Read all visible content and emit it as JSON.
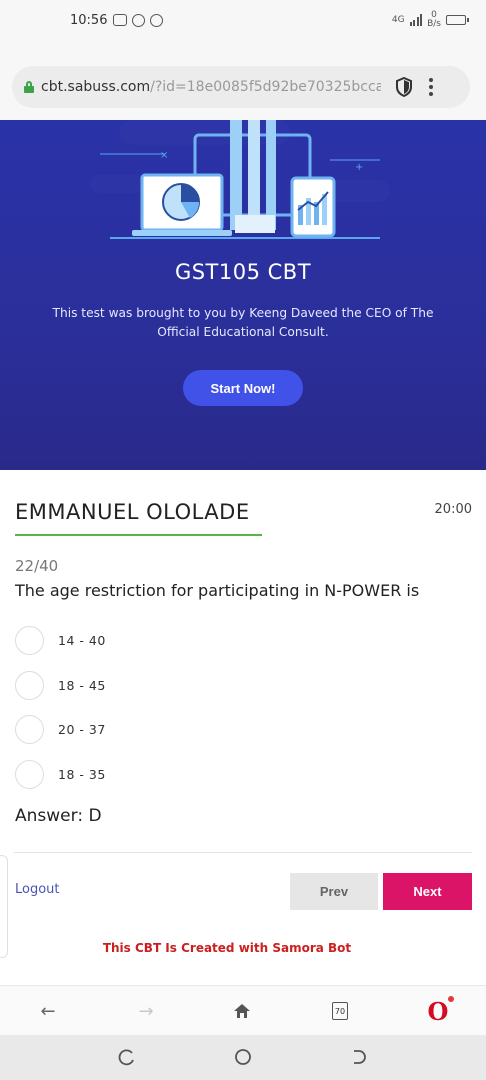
{
  "status_bar": {
    "time": "10:56",
    "network_label": "4G",
    "speed_value": "0",
    "speed_unit": "B/s"
  },
  "browser": {
    "url_domain": "cbt.sabuss.com",
    "url_path": "/?id=18e0085f5d92be70325bcca",
    "tab_count": "70"
  },
  "hero": {
    "title": "GST105 CBT",
    "subtitle": "This test was brought to you by Keeng Daveed the CEO of The Official Educational Consult.",
    "start_button": "Start Now!"
  },
  "quiz": {
    "student_name": "EMMANUEL OLOLADE",
    "timer": "20:00",
    "counter": "22/40",
    "question": "The age restriction for participating in N-POWER is",
    "options": [
      {
        "label": "14 - 40"
      },
      {
        "label": "18 - 45"
      },
      {
        "label": "20 - 37"
      },
      {
        "label": "18 - 35"
      }
    ],
    "answer": "Answer: D"
  },
  "actions": {
    "logout": "Logout",
    "prev": "Prev",
    "next": "Next"
  },
  "footer": {
    "credit": "This CBT Is Created with Samora Bot"
  },
  "colors": {
    "hero_bg": "#2b2f9a",
    "start_button": "#4152e8",
    "name_underline": "#54b848",
    "next_button": "#dc1467",
    "credit_text": "#cc1f1f",
    "link": "#4a55b5"
  }
}
